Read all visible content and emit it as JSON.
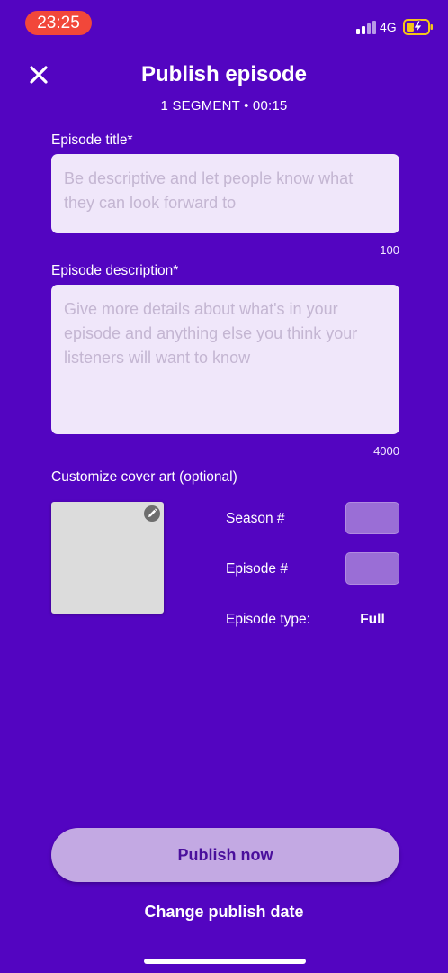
{
  "status_bar": {
    "time": "23:25",
    "network": "4G",
    "battery_state": "charging",
    "icons": [
      "signal-icon",
      "battery-icon"
    ]
  },
  "header": {
    "close_icon": "close-icon",
    "title": "Publish episode",
    "segment_info": "1 SEGMENT • 00:15"
  },
  "form": {
    "title_field": {
      "label": "Episode title*",
      "value": "",
      "placeholder": "Be descriptive and let people know what they can look forward to",
      "counter": "100"
    },
    "description_field": {
      "label": "Episode description*",
      "value": "",
      "placeholder": "Give more details about what's in your episode and anything else you think your listeners will want to know",
      "counter": "4000"
    },
    "cover_art": {
      "label": "Customize cover art (optional)",
      "edit_icon": "pencil-icon"
    },
    "season": {
      "label": "Season #",
      "value": ""
    },
    "episode_number": {
      "label": "Episode #",
      "value": ""
    },
    "episode_type": {
      "label": "Episode type:",
      "value": "Full"
    }
  },
  "actions": {
    "publish_now": "Publish now",
    "change_date": "Change publish date"
  },
  "colors": {
    "background": "#5305c1",
    "field_background": "#f0e7fa",
    "publish_button": "#c3a9e3",
    "publish_text": "#4a0f9c",
    "time_pill": "#f2473a",
    "battery_fill": "#f5c518"
  }
}
